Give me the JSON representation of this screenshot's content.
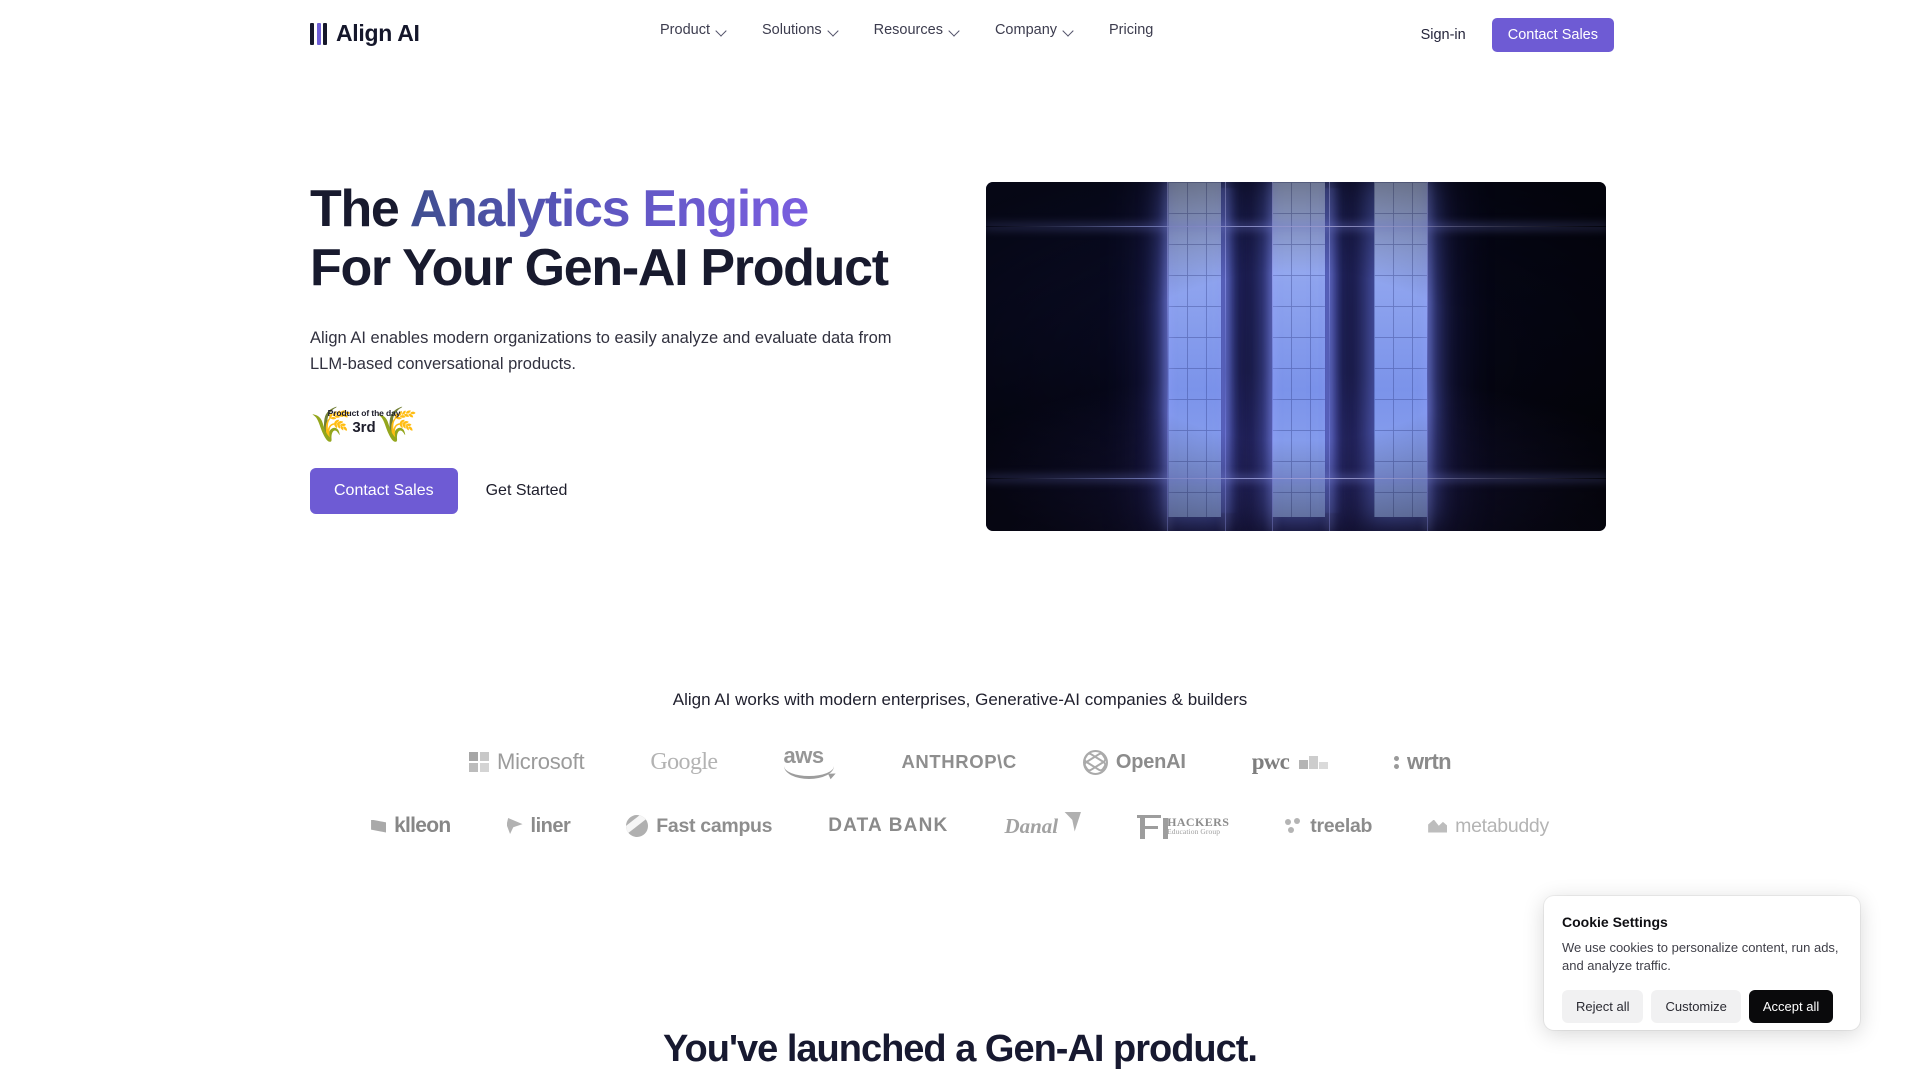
{
  "nav": {
    "logo_text": "Align AI",
    "links": [
      {
        "label": "Product",
        "has_caret": true
      },
      {
        "label": "Solutions",
        "has_caret": true
      },
      {
        "label": "Resources",
        "has_caret": true
      },
      {
        "label": "Company",
        "has_caret": true
      },
      {
        "label": "Pricing",
        "has_caret": false
      }
    ],
    "signin_label": "Sign-in",
    "contact_label": "Contact Sales"
  },
  "hero": {
    "headline_part1": "The ",
    "headline_accent": "Analytics Engine",
    "headline_line2": "For Your Gen-AI Product",
    "subtext": "Align AI enables modern organizations to easily analyze and evaluate data from LLM-based conversational products.",
    "badge": {
      "title": "Product of the day",
      "rank": "3rd"
    },
    "cta_primary": "Contact Sales",
    "cta_secondary": "Get Started"
  },
  "logos": {
    "caption": "Align AI works with modern enterprises, Generative-AI companies & builders",
    "row1": [
      {
        "name": "Microsoft"
      },
      {
        "name": "Google"
      },
      {
        "name": "aws"
      },
      {
        "name": "ANTHROP\\C"
      },
      {
        "name": "OpenAI"
      },
      {
        "name": "pwc"
      },
      {
        "name": "wrtn"
      }
    ],
    "row2": [
      {
        "name": "klleon"
      },
      {
        "name": "liner"
      },
      {
        "name": "Fast campus"
      },
      {
        "name": "DATA BANK"
      },
      {
        "name": "Danal"
      },
      {
        "name": "HACKERS",
        "sub": "Education Group"
      },
      {
        "name": "treelab"
      },
      {
        "name": "metabuddy"
      }
    ]
  },
  "section": {
    "heading": "You've launched a Gen-AI product."
  },
  "cookie": {
    "title": "Cookie Settings",
    "body": "We use cookies to personalize content, run ads, and analyze traffic.",
    "reject_label": "Reject all",
    "customize_label": "Customize",
    "accept_label": "Accept all"
  },
  "colors": {
    "accent_purple": "#6e5bd4",
    "headline_dark": "#181a2e",
    "accent_gradient_start": "#3f4e8f",
    "accent_gradient_end": "#7b5fe0"
  }
}
